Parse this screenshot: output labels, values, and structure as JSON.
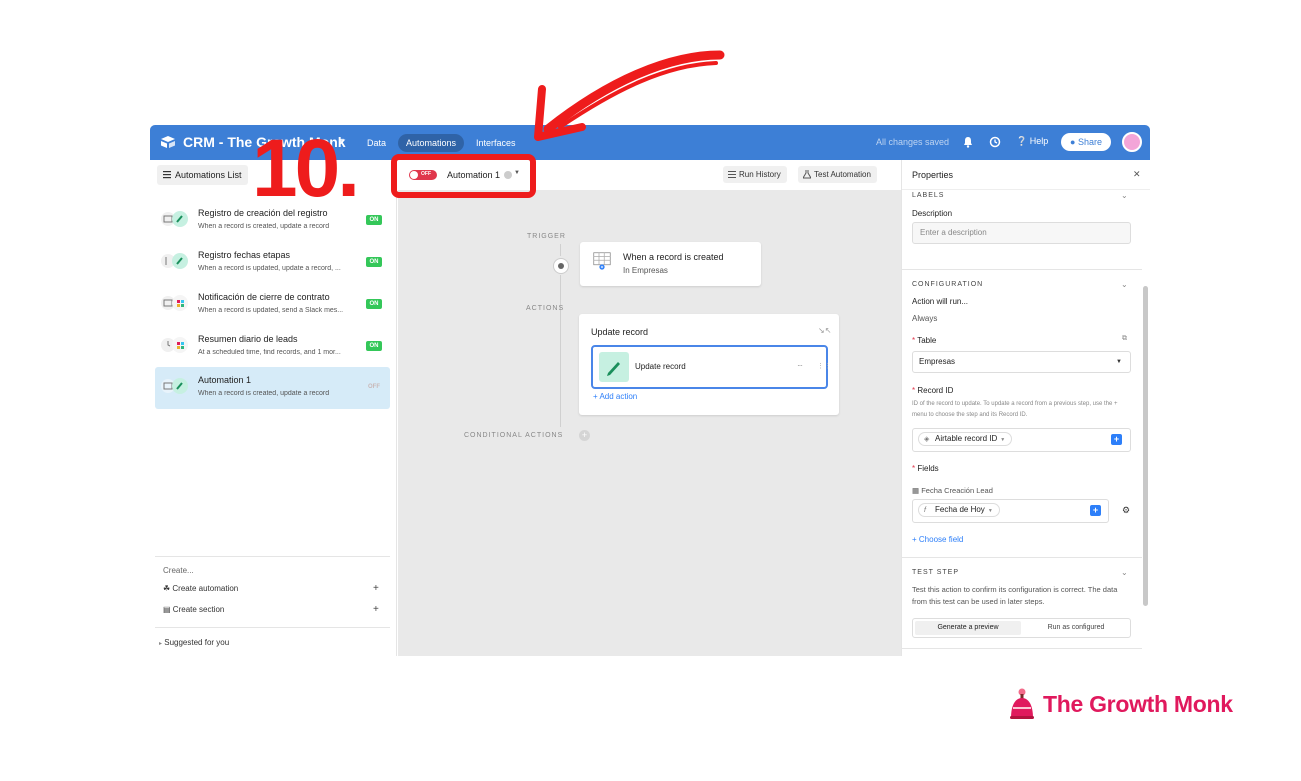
{
  "topbar": {
    "base_name": "CRM - The Growth Monk",
    "nav": [
      "Data",
      "Automations",
      "Interfaces"
    ],
    "saved_status": "All changes saved",
    "help_label": "Help",
    "share_label": "Share"
  },
  "sidebar": {
    "list_button": "Automations List",
    "automations": [
      {
        "name": "Registro de creación del registro",
        "description": "When a record is created, update a record",
        "status": "ON"
      },
      {
        "name": "Registro fechas etapas",
        "description": "When a record is updated, update a record, ...",
        "status": "ON"
      },
      {
        "name": "Notificación de cierre de contrato",
        "description": "When a record is updated, send a Slack mes...",
        "status": "ON"
      },
      {
        "name": "Resumen diario de leads",
        "description": "At a scheduled time, find records, and 1 mor...",
        "status": "ON"
      },
      {
        "name": "Automation 1",
        "description": "When a record is created, update a record",
        "status": "OFF"
      }
    ],
    "create_label": "Create...",
    "create_automation": "Create automation",
    "create_section": "Create section",
    "suggested": "Suggested for you"
  },
  "canvas": {
    "toggle_label": "OFF",
    "automation_name": "Automation 1",
    "run_history": "Run History",
    "test_automation": "Test Automation",
    "trigger_label": "TRIGGER",
    "trigger_title": "When a record is created",
    "trigger_table": "In Empresas",
    "actions_label": "ACTIONS",
    "actions_card_title": "Update record",
    "step_name": "Update record",
    "step_menu": "···",
    "add_action": "+ Add action",
    "conditional_label": "CONDITIONAL ACTIONS"
  },
  "properties": {
    "title": "Properties",
    "labels_section": "LABELS",
    "description_label": "Description",
    "description_placeholder": "Enter a description",
    "configuration_section": "CONFIGURATION",
    "action_will_run": "Action will run...",
    "always": "Always",
    "table_label": "Table",
    "table_value": "Empresas",
    "record_id_label": "Record ID",
    "record_id_help": "ID of the record to update. To update a record from a previous step, use the + menu to choose the step and its Record ID.",
    "record_id_value": "Airtable record ID",
    "fields_label": "Fields",
    "field_name": "Fecha Creación Lead",
    "field_value": "Fecha de Hoy",
    "choose_field": "+ Choose field",
    "test_step_section": "TEST STEP",
    "test_step_desc": "Test this action to confirm its configuration is correct. The data from this test can be used in later steps.",
    "generate_preview": "Generate a preview",
    "run_as_configured": "Run as configured"
  },
  "overlay": {
    "step_number": "10."
  },
  "brand": {
    "name": "The Growth Monk"
  },
  "colors": {
    "topbar": "#3d7fd6",
    "annotation_red": "#ee1c1c",
    "brand_pink": "#e0195d",
    "on_badge": "#34c759"
  }
}
